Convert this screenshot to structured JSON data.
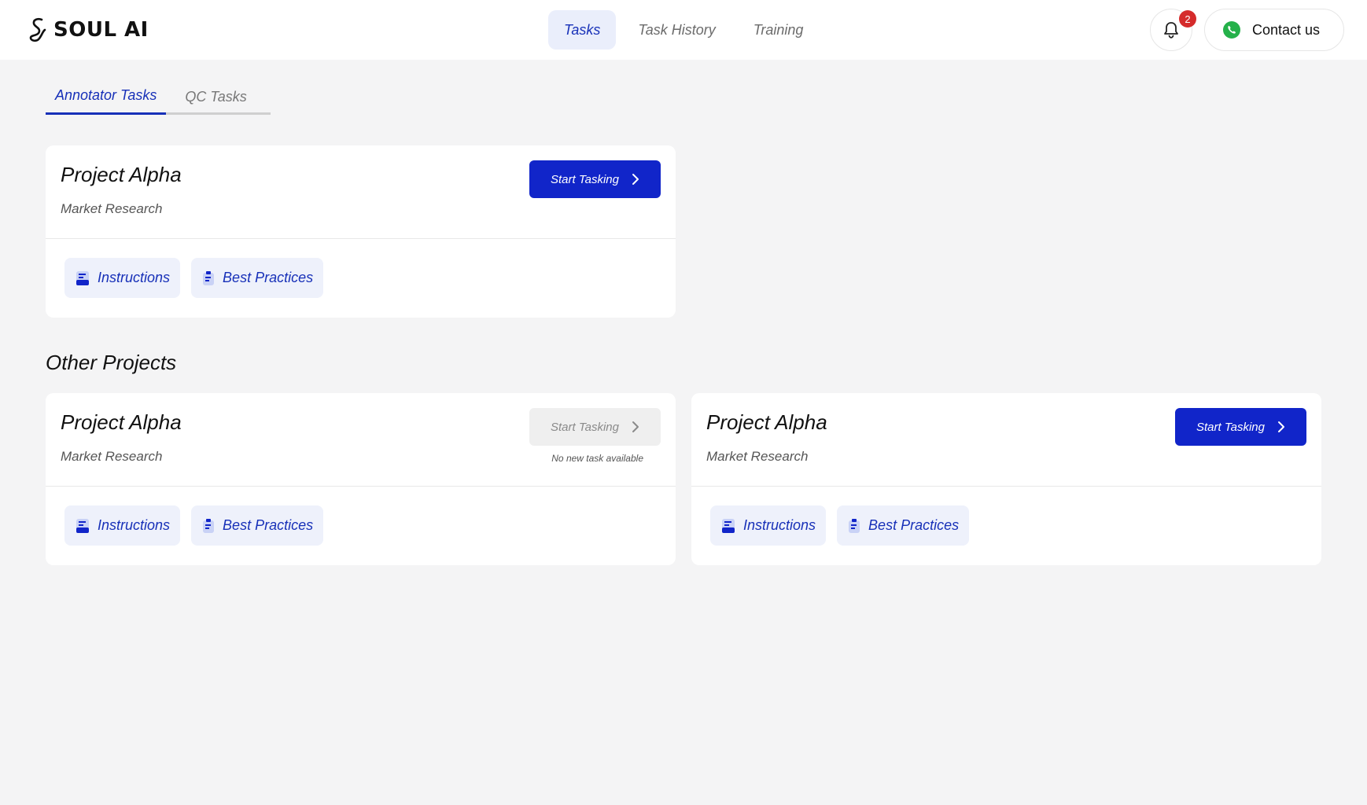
{
  "app": {
    "brand": "SOUL AI"
  },
  "nav": {
    "items": [
      {
        "label": "Tasks",
        "active": true
      },
      {
        "label": "Task History",
        "active": false
      },
      {
        "label": "Training",
        "active": false
      }
    ]
  },
  "notifications": {
    "count": "2"
  },
  "contact": {
    "label": "Contact us"
  },
  "tabs": [
    {
      "label": "Annotator Tasks",
      "active": true
    },
    {
      "label": "QC Tasks",
      "active": false
    }
  ],
  "current_project": {
    "title": "Project Alpha",
    "subtitle": "Market Research",
    "start_label": "Start Tasking",
    "instructions_label": "Instructions",
    "best_practices_label": "Best Practices"
  },
  "other_projects": {
    "heading": "Other Projects",
    "items": [
      {
        "title": "Project Alpha",
        "subtitle": "Market Research",
        "start_label": "Start Tasking",
        "disabled": true,
        "note": "No new task available",
        "instructions_label": "Instructions",
        "best_practices_label": "Best Practices"
      },
      {
        "title": "Project Alpha",
        "subtitle": "Market Research",
        "start_label": "Start Tasking",
        "disabled": false,
        "instructions_label": "Instructions",
        "best_practices_label": "Best Practices"
      }
    ]
  },
  "colors": {
    "primary": "#1125c9",
    "accent_text": "#1730b8",
    "pill_bg": "#eef1fb",
    "badge": "#d52b2b",
    "background": "#f4f4f5"
  }
}
